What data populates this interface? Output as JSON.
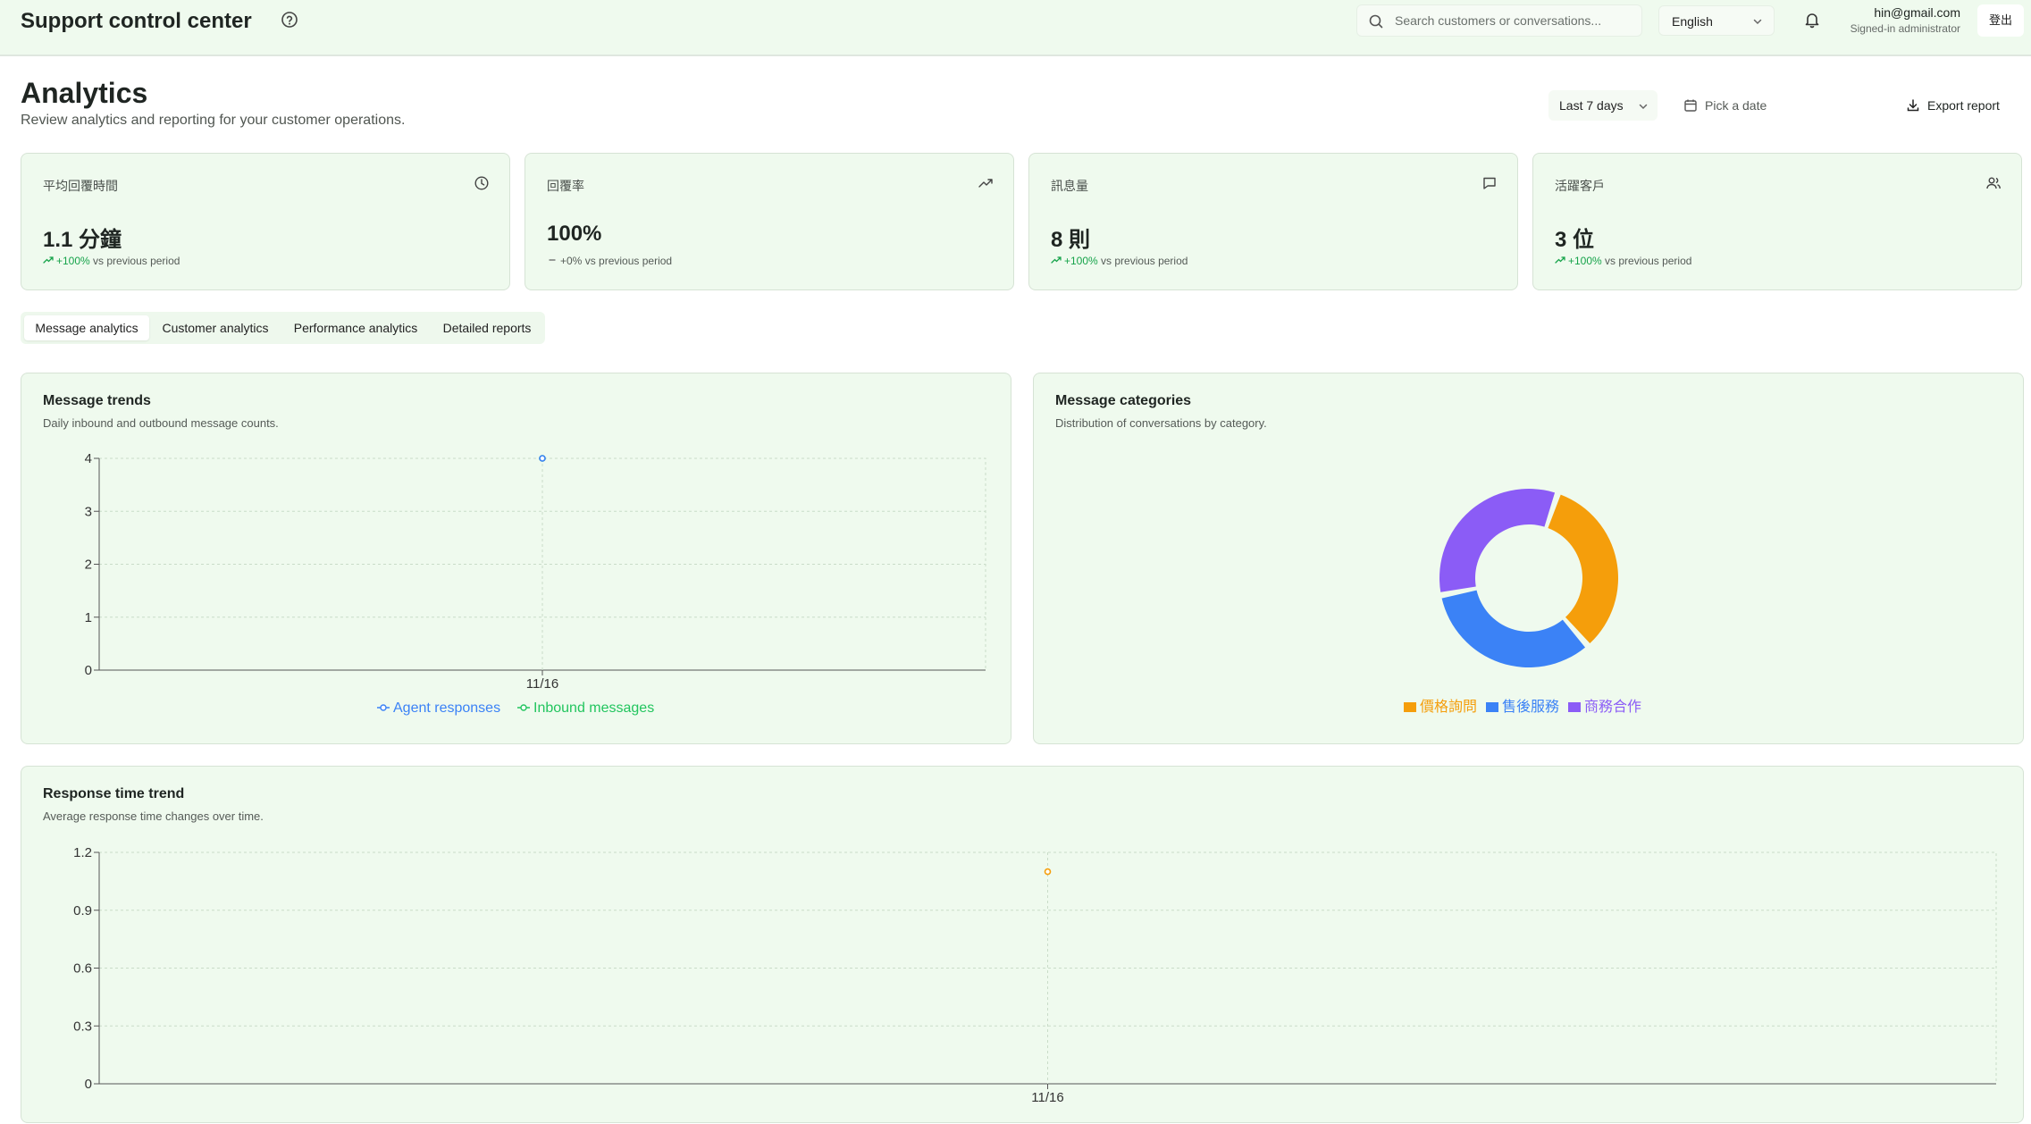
{
  "header": {
    "app_title": "Support control center",
    "search_placeholder": "Search customers or conversations...",
    "language": "English",
    "user_email": "hin@gmail.com",
    "user_role": "Signed-in administrator",
    "logout_label": "登出"
  },
  "page": {
    "title": "Analytics",
    "subtitle": "Review analytics and reporting for your customer operations.",
    "range_label": "Last 7 days",
    "date_placeholder": "Pick a date",
    "export_label": "Export report"
  },
  "kpis": [
    {
      "label": "平均回覆時間",
      "value": "1.1 分鐘",
      "icon": "clock-icon",
      "trend_value": "+100%",
      "trend_suffix": "vs previous period",
      "trend": "up"
    },
    {
      "label": "回覆率",
      "value": "100%",
      "icon": "trending-up-icon",
      "trend_value": "+0%",
      "trend_suffix": "vs previous period",
      "trend": "flat"
    },
    {
      "label": "訊息量",
      "value": "8 則",
      "icon": "message-icon",
      "trend_value": "+100%",
      "trend_suffix": "vs previous period",
      "trend": "up"
    },
    {
      "label": "活躍客戶",
      "value": "3 位",
      "icon": "users-icon",
      "trend_value": "+100%",
      "trend_suffix": "vs previous period",
      "trend": "up"
    }
  ],
  "tabs": [
    "Message analytics",
    "Customer analytics",
    "Performance analytics",
    "Detailed reports"
  ],
  "colors": {
    "agent": "#3b82f6",
    "inbound": "#22c55e",
    "amber": "#f59e0b",
    "blue": "#3b82f6",
    "purple": "#8b5cf6",
    "trend_up": "#16a34a"
  },
  "panels": {
    "trends": {
      "title": "Message trends",
      "subtitle": "Daily inbound and outbound message counts."
    },
    "categories": {
      "title": "Message categories",
      "subtitle": "Distribution of conversations by category."
    },
    "response": {
      "title": "Response time trend",
      "subtitle": "Average response time changes over time."
    }
  },
  "chart_data": [
    {
      "type": "line",
      "x": [
        "11/16"
      ],
      "ylim": [
        0,
        4
      ],
      "yticks": [
        0,
        1,
        2,
        3,
        4
      ],
      "series": [
        {
          "name": "Agent responses",
          "values": [
            4
          ],
          "color": "#3b82f6"
        },
        {
          "name": "Inbound messages",
          "values": [
            4
          ],
          "color": "#22c55e"
        }
      ],
      "grid": true,
      "legend": "bottom"
    },
    {
      "type": "pie",
      "donut": true,
      "categories": [
        "價格詢問",
        "售後服務",
        "商務合作"
      ],
      "values": [
        1,
        1,
        1
      ],
      "colors": [
        "#f59e0b",
        "#3b82f6",
        "#8b5cf6"
      ],
      "legend": "bottom"
    },
    {
      "type": "line",
      "x": [
        "11/16"
      ],
      "ylim": [
        0,
        1.2
      ],
      "yticks": [
        0,
        0.3,
        0.6,
        0.9,
        1.2
      ],
      "series": [
        {
          "values": [
            1.1
          ],
          "color": "#f59e0b"
        }
      ],
      "grid": true
    }
  ]
}
